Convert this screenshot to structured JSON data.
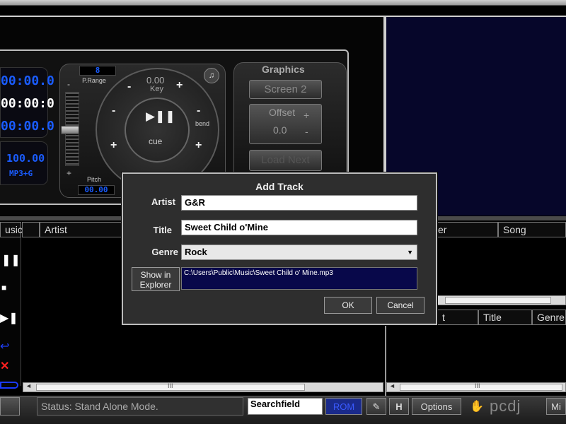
{
  "deck": {
    "time_elapsed": "00:00.0",
    "time_white": "00:00:0",
    "time_remain": "00:00.0",
    "bpm": "100.00",
    "format": "MP3+G",
    "prange_value": "8",
    "prange_label": "P.Range",
    "key_value": "0.00",
    "key_label": "Key",
    "pitch_label": "Pitch",
    "pitch_value": "00.00",
    "bend_label": "bend",
    "cue_label": "cue",
    "play_pause_glyph": "▶❚❚",
    "plus": "+",
    "minus": "-"
  },
  "graphics": {
    "title": "Graphics",
    "screen_button": "Screen 2",
    "offset_label": "Offset",
    "offset_value": "0.0",
    "load_next": "Load Next"
  },
  "browser": {
    "left_headers": [
      "usic",
      "",
      "Artist"
    ],
    "right_headers": [
      "er",
      "Song"
    ],
    "lower_headers": [
      "t",
      "Title",
      "Genre"
    ],
    "scroll_grip": "III"
  },
  "dialog": {
    "title": "Add Track",
    "artist_label": "Artist",
    "artist_value": "G&R",
    "title_label": "Title",
    "title_value": "Sweet Child o'Mine",
    "genre_label": "Genre",
    "genre_value": "Rock",
    "show_in_explorer": "Show in Explorer",
    "path": "C:\\Users\\Public\\Music\\Sweet Child o' Mine.mp3",
    "ok": "OK",
    "cancel": "Cancel"
  },
  "bottom": {
    "status": "Status: Stand Alone Mode.",
    "search_value": "Searchfield",
    "rom_label": "ROM",
    "h_label": "H",
    "options": "Options",
    "logo": "pcdj",
    "mi": "Mi"
  },
  "colors": {
    "accent_blue": "#1a5cff",
    "video_bg": "#06062a",
    "path_bg": "#08084a"
  }
}
